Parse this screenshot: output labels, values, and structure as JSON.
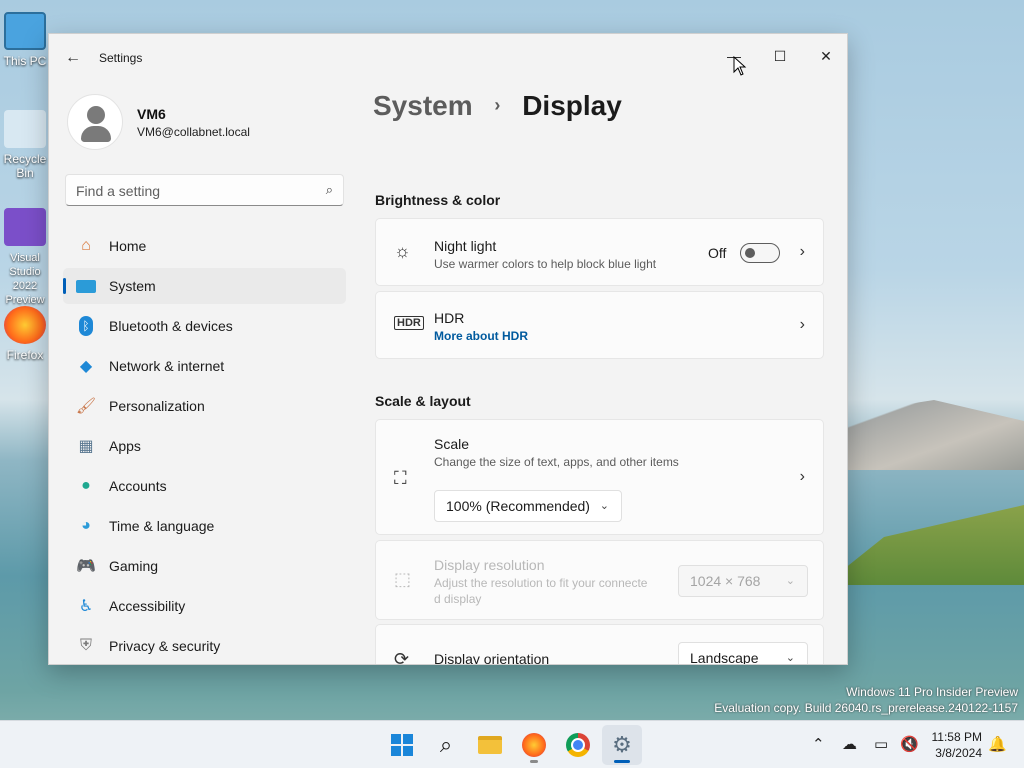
{
  "desktop": {
    "icons": [
      {
        "label": "This PC"
      },
      {
        "label": "Recycle Bin"
      },
      {
        "label": "Visual Studio 2022 Preview"
      },
      {
        "label": "Firefox"
      }
    ],
    "watermark": {
      "line1": "Windows 11 Pro Insider Preview",
      "line2": "Evaluation copy. Build 26040.rs_prerelease.240122-1157"
    }
  },
  "window": {
    "title": "Settings",
    "controls": {
      "minimize": "minimize-icon",
      "maximize": "maximize-icon",
      "close": "close-icon"
    }
  },
  "profile": {
    "name": "VM6",
    "email": "VM6@collabnet.local"
  },
  "search": {
    "placeholder": "Find a setting"
  },
  "nav": {
    "items": [
      {
        "label": "Home",
        "icon": "home-icon"
      },
      {
        "label": "System",
        "icon": "system-icon",
        "active": true
      },
      {
        "label": "Bluetooth & devices",
        "icon": "bluetooth-icon"
      },
      {
        "label": "Network & internet",
        "icon": "network-icon"
      },
      {
        "label": "Personalization",
        "icon": "brush-icon"
      },
      {
        "label": "Apps",
        "icon": "apps-icon"
      },
      {
        "label": "Accounts",
        "icon": "accounts-icon"
      },
      {
        "label": "Time & language",
        "icon": "globe-icon"
      },
      {
        "label": "Gaming",
        "icon": "gamepad-icon"
      },
      {
        "label": "Accessibility",
        "icon": "accessibility-icon"
      },
      {
        "label": "Privacy & security",
        "icon": "shield-icon"
      }
    ]
  },
  "breadcrumb": {
    "parent": "System",
    "separator": "›",
    "current": "Display"
  },
  "sections": {
    "brightness": {
      "title": "Brightness & color",
      "night_light": {
        "title": "Night light",
        "subtitle": "Use warmer colors to help block blue light",
        "state_label": "Off",
        "enabled": false
      },
      "hdr": {
        "title": "HDR",
        "link": "More about HDR"
      }
    },
    "scale_layout": {
      "title": "Scale & layout",
      "scale": {
        "title": "Scale",
        "subtitle": "Change the size of text, apps, and other items",
        "value": "100% (Recommended)"
      },
      "resolution": {
        "title": "Display resolution",
        "subtitle_line1": "Adjust the resolution to fit your connecte",
        "subtitle_line2": "d display",
        "value": "1024 × 768",
        "disabled": true
      },
      "orientation": {
        "title": "Display orientation",
        "value": "Landscape"
      }
    }
  },
  "taskbar": {
    "apps": [
      "windows-start-icon",
      "search-icon",
      "file-explorer-icon",
      "firefox-icon",
      "chrome-icon",
      "settings-icon"
    ],
    "clock": {
      "time": "11:58 PM",
      "date": "3/8/2024"
    }
  },
  "colors": {
    "accent": "#005fb8",
    "link": "#005a9e",
    "window_bg": "#f3f3f3",
    "card_bg": "#fbfbfb"
  }
}
